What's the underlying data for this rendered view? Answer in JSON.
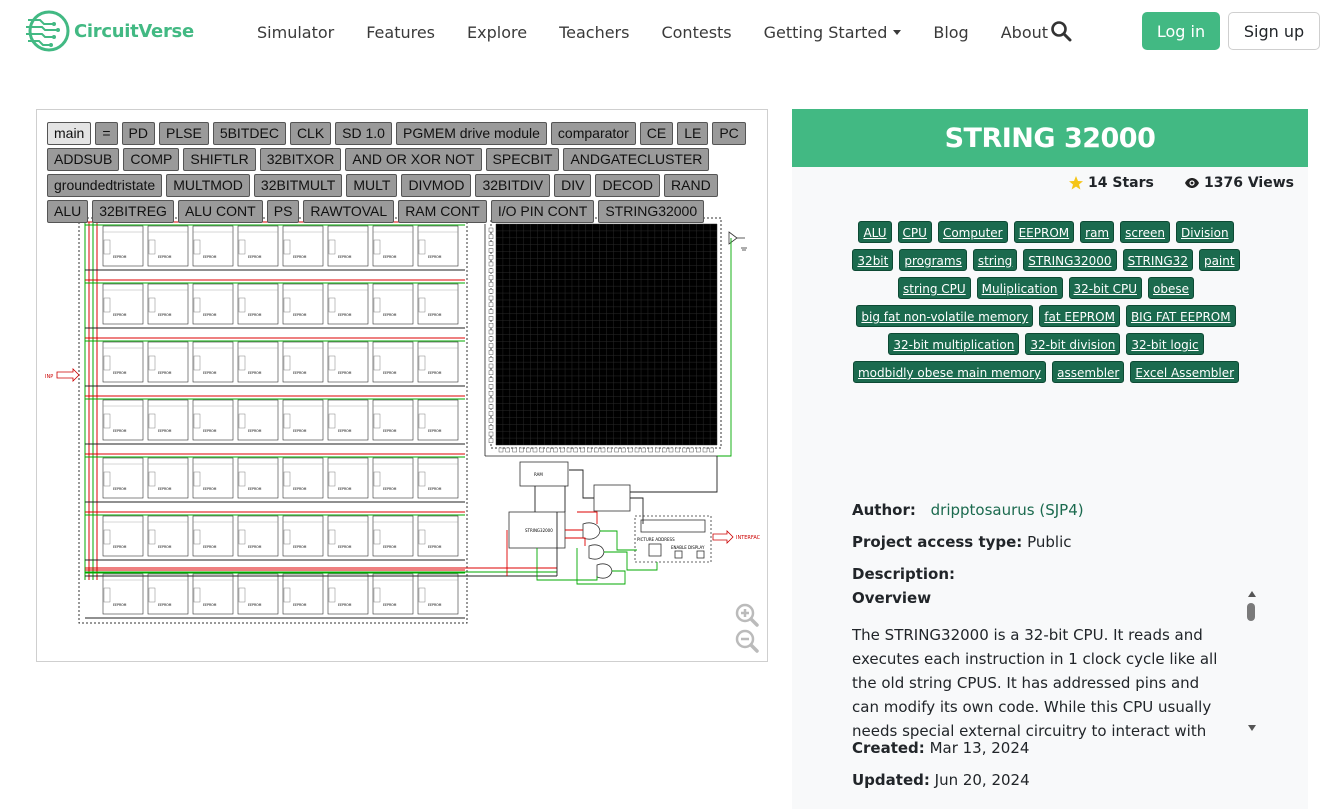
{
  "brand": {
    "name": "CircuitVerse",
    "color": "#42b983"
  },
  "nav": {
    "links": [
      "Simulator",
      "Features",
      "Explore",
      "Teachers",
      "Contests",
      "Getting Started",
      "Blog",
      "About"
    ],
    "login": "Log in",
    "signup": "Sign up"
  },
  "circuit": {
    "tabs": [
      "main",
      "=",
      "PD",
      "PLSE",
      "5BITDEC",
      "CLK",
      "SD 1.0",
      "PGMEM drive module",
      "comparator",
      "CE",
      "LE",
      "PC",
      "ADDSUB",
      "COMP",
      "SHIFTLR",
      "32BITXOR",
      "AND OR XOR NOT",
      "SPECBIT",
      "ANDGATECLUSTER",
      "groundedtristate",
      "MULTMOD",
      "32BITMULT",
      "MULT",
      "DIVMOD",
      "32BITDIV",
      "DIV",
      "DECOD",
      "RAND",
      "ALU",
      "32BITREG",
      "ALU CONT",
      "PS",
      "RAWTOVAL",
      "RAM CONT",
      "I/O PIN CONT",
      "STRING32000"
    ],
    "active_tab": "main",
    "labels": {
      "chip": "EEPROM",
      "input": "INP",
      "interface": "INTERFAC",
      "ram": "RAM",
      "string": "STRING32000",
      "picture": "PICTURE ADDRESS",
      "enable": "ENABLE DISPLAY"
    }
  },
  "project": {
    "title": "STRING 32000",
    "stars": "14 Stars",
    "views": "1376 Views",
    "tags": [
      "ALU",
      "CPU",
      "Computer",
      "EEPROM",
      "ram",
      "screen",
      "Division",
      "32bit",
      "programs",
      "string",
      "STRING32000",
      "STRING32",
      "paint",
      "string CPU",
      "Muliplication",
      "32-bit CPU",
      "obese",
      "big fat non-volatile memory",
      "fat EEPROM",
      "BIG FAT EEPROM",
      "32-bit multiplication",
      "32-bit division",
      "32-bit logic",
      "modbidly obese main memory",
      "assembler",
      "Excel Assembler"
    ],
    "author_label": "Author:",
    "author": "dripptosaurus (SJP4)",
    "access_label": "Project access type:",
    "access": "Public",
    "description_label": "Description:",
    "overview_heading": "Overview",
    "description": "The STRING32000 is a 32-bit CPU. It reads and executes each instruction in 1 clock cycle like all the old string CPUS. It has addressed pins and can modify its own code. While this CPU usually needs special external circuitry to interact with",
    "created_label": "Created:",
    "created": "Mar 13, 2024",
    "updated_label": "Updated:",
    "updated": "Jun 20, 2024"
  },
  "icons": [
    "circuitverse-logo-icon",
    "search-icon",
    "caret-down-icon",
    "star-icon",
    "eye-icon",
    "zoom-in-icon",
    "zoom-out-icon"
  ],
  "colors": {
    "accent": "#42b983",
    "tag": "#1b6a4e",
    "star": "#f5c518"
  }
}
